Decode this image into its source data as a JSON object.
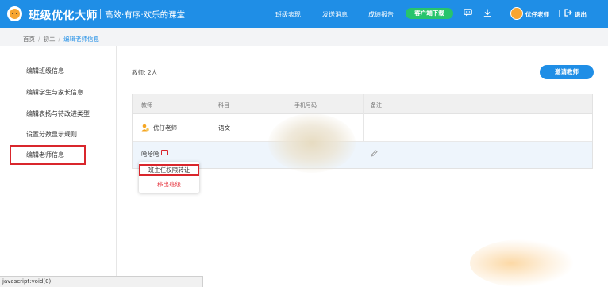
{
  "header": {
    "app_name": "班级优化大师",
    "slogan": "高效·有序·欢乐的课堂",
    "nav": [
      "班级表现",
      "发送消息",
      "成绩报告"
    ],
    "download_label": "客户端下载",
    "user_name": "优仔老师",
    "logout_label": "退出",
    "icons": [
      "logo-icon",
      "message-icon",
      "download-icon",
      "avatar",
      "logout-icon"
    ],
    "brand_color": "#1f8ee6",
    "download_color": "#27c46c"
  },
  "breadcrumb": [
    "首页",
    "初二",
    "编辑老师信息"
  ],
  "sidebar": {
    "items": [
      {
        "label": "编辑班级信息"
      },
      {
        "label": "编辑学生与家长信息"
      },
      {
        "label": "编辑表扬与待改进类型"
      },
      {
        "label": "设置分数显示规则"
      },
      {
        "label": "编辑老师信息"
      }
    ],
    "active_index": 4
  },
  "content": {
    "teacher_count": "教师: 2人",
    "invite_label": "邀请教师",
    "table": {
      "headers": [
        "教师",
        "科目",
        "手机号码",
        "备注"
      ],
      "rows": [
        {
          "teacher": "优仔老师",
          "subject": "语文",
          "phone": "",
          "note": ""
        },
        {
          "teacher": "哈哈哈",
          "subject": "",
          "phone": "",
          "note": ""
        }
      ]
    },
    "dropdown": [
      "班主任权限转让",
      "移出班级"
    ]
  },
  "status_bar": "javascript:void(0)",
  "accent_red": "#d9262c"
}
